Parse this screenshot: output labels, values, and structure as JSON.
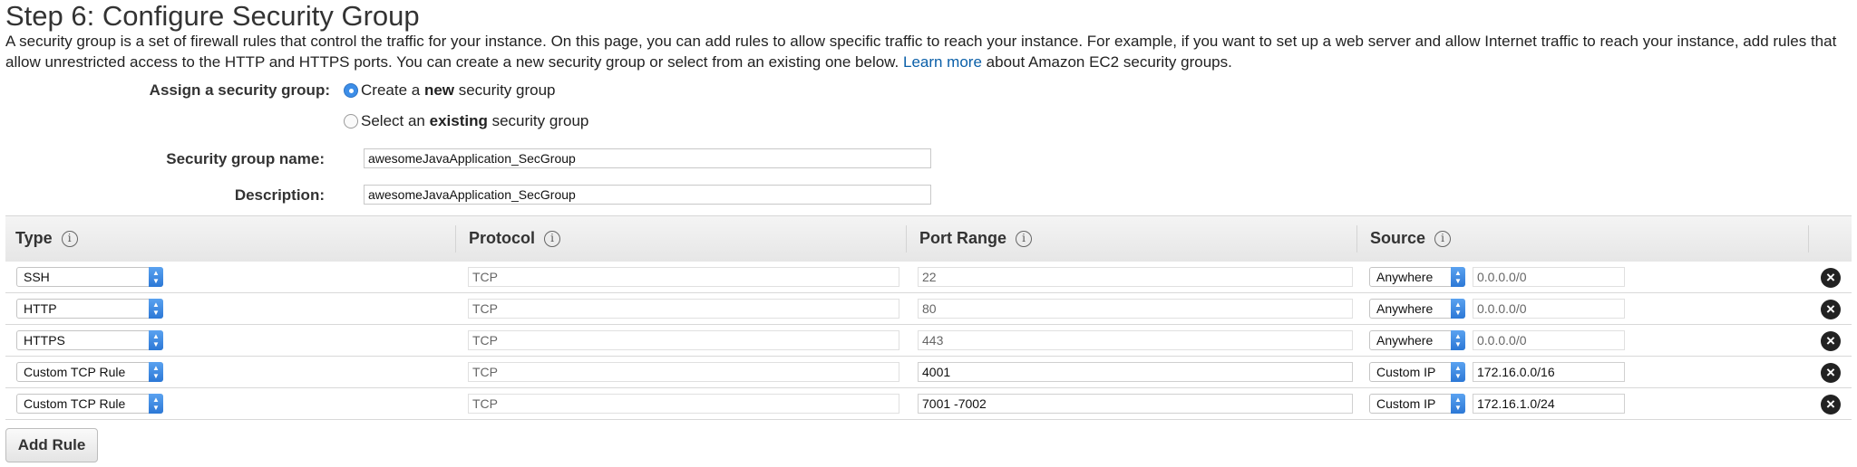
{
  "page": {
    "title": "Step 6: Configure Security Group",
    "intro_text": "A security group is a set of firewall rules that control the traffic for your instance. On this page, you can add rules to allow specific traffic to reach your instance. For example, if you want to set up a web server and allow Internet traffic to reach your instance, add rules that allow unrestricted access to the HTTP and HTTPS ports. You can create a new security group or select from an existing one below.",
    "learn_more_link": "Learn more",
    "intro_suffix": "about Amazon EC2 security groups."
  },
  "assign": {
    "label": "Assign a security group:",
    "option_new_prefix": "Create a ",
    "option_new_bold": "new",
    "option_new_suffix": " security group",
    "option_existing_prefix": "Select an ",
    "option_existing_bold": "existing",
    "option_existing_suffix": " security group",
    "selected": "new"
  },
  "form": {
    "name_label": "Security group name:",
    "name_value": "awesomeJavaApplication_SecGroup",
    "description_label": "Description:",
    "description_value": "awesomeJavaApplication_SecGroup"
  },
  "table": {
    "headers": {
      "type": "Type",
      "protocol": "Protocol",
      "port_range": "Port Range",
      "source": "Source"
    },
    "info_icon": "info-icon",
    "rows": [
      {
        "type": "SSH",
        "protocol": "TCP",
        "port_range": "22",
        "source_type": "Anywhere",
        "source_cidr": "0.0.0.0/0"
      },
      {
        "type": "HTTP",
        "protocol": "TCP",
        "port_range": "80",
        "source_type": "Anywhere",
        "source_cidr": "0.0.0.0/0"
      },
      {
        "type": "HTTPS",
        "protocol": "TCP",
        "port_range": "443",
        "source_type": "Anywhere",
        "source_cidr": "0.0.0.0/0"
      },
      {
        "type": "Custom TCP Rule",
        "protocol": "TCP",
        "port_range": "4001",
        "source_type": "Custom IP",
        "source_cidr": "172.16.0.0/16"
      },
      {
        "type": "Custom TCP Rule",
        "protocol": "TCP",
        "port_range": "7001 -7002",
        "source_type": "Custom IP",
        "source_cidr": "172.16.1.0/24"
      }
    ]
  },
  "actions": {
    "add_rule": "Add Rule"
  },
  "colors": {
    "link": "#0a5fa8",
    "select_accent": "#2c78d6",
    "remove_icon": "#222222"
  }
}
